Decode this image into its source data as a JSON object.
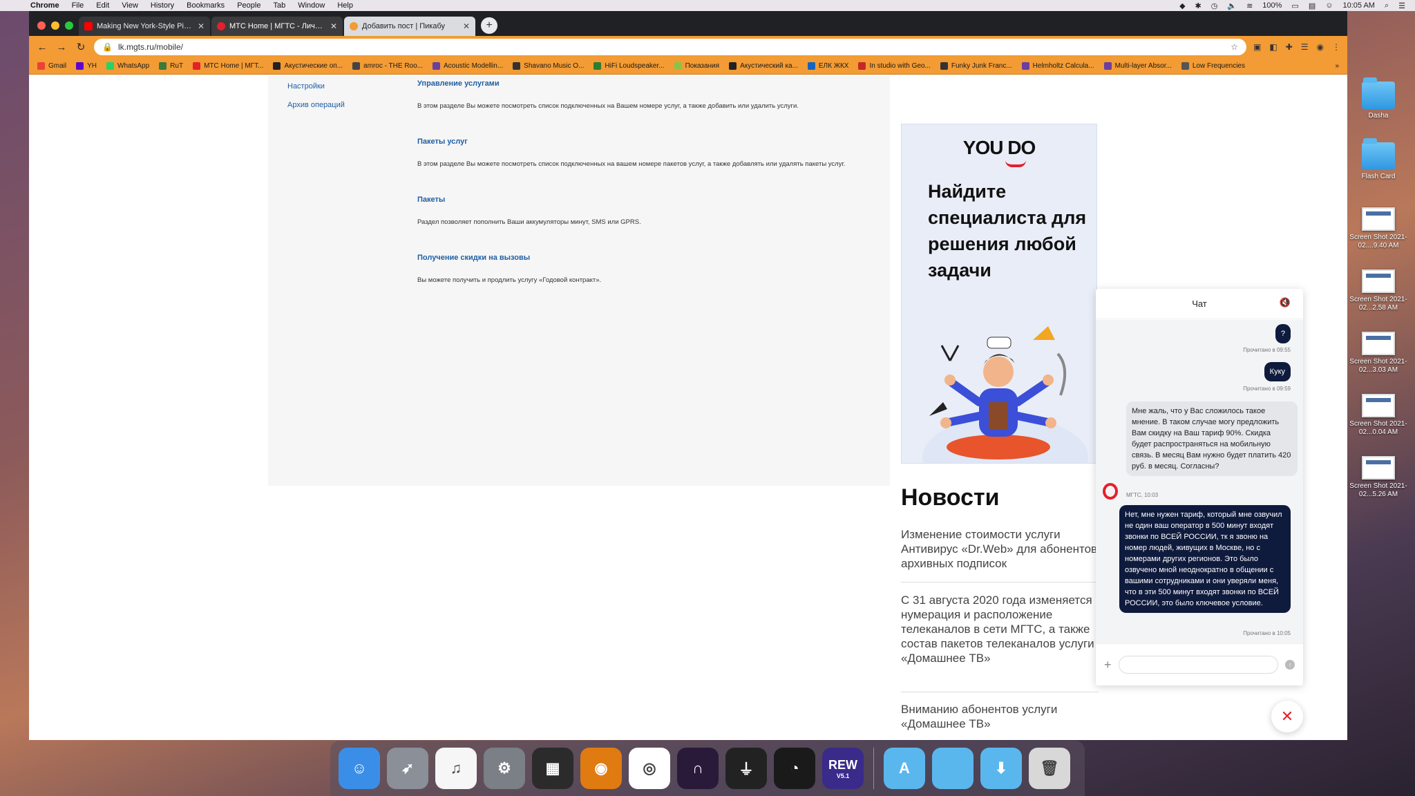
{
  "menubar": {
    "apple": "",
    "items": [
      "Chrome",
      "File",
      "Edit",
      "View",
      "History",
      "Bookmarks",
      "People",
      "Tab",
      "Window",
      "Help"
    ],
    "battery": "100%",
    "time": "10:05 AM"
  },
  "tabs": [
    {
      "title": "Making New York-Style Pizza a",
      "color": "#ff0000"
    },
    {
      "title": "МТС Home | МГТС - Личный ка",
      "color": "#e4202a"
    },
    {
      "title": "Добавить пост | Пикабу",
      "color": "#f39b34"
    }
  ],
  "address": {
    "url": "lk.mgts.ru/mobile/"
  },
  "bookmarks": [
    {
      "label": "Gmail",
      "color": "#ea4335"
    },
    {
      "label": "YH",
      "color": "#6001d2"
    },
    {
      "label": "WhatsApp",
      "color": "#25d366"
    },
    {
      "label": "RuT",
      "color": "#3a7a3a"
    },
    {
      "label": "МТС Home | МГТ...",
      "color": "#e4202a"
    },
    {
      "label": "Акустические оп...",
      "color": "#222222"
    },
    {
      "label": "amroc - THE Roo...",
      "color": "#444444"
    },
    {
      "label": "Acoustic Modellin...",
      "color": "#6b3fa0"
    },
    {
      "label": "Shavano Music O...",
      "color": "#333333"
    },
    {
      "label": "HiFi Loudspeaker...",
      "color": "#2e7d32"
    },
    {
      "label": "Показания",
      "color": "#8bc34a"
    },
    {
      "label": "Акустический ка...",
      "color": "#222222"
    },
    {
      "label": "ЕЛК ЖКХ",
      "color": "#1565c0"
    },
    {
      "label": "In studio with Geo...",
      "color": "#c62828"
    },
    {
      "label": "Funky Junk Franc...",
      "color": "#333333"
    },
    {
      "label": "Helmholtz Calcula...",
      "color": "#6b3fa0"
    },
    {
      "label": "Multi-layer Absor...",
      "color": "#6b3fa0"
    },
    {
      "label": "Low Frequencies",
      "color": "#555555"
    }
  ],
  "sidebar": {
    "items": [
      "Настройки",
      "Архив операций"
    ]
  },
  "services": [
    {
      "title": "Управление услугами",
      "desc": "В этом разделе Вы можете посмотреть список подключенных на Вашем номере услуг, а также добавить или удалить услуги."
    },
    {
      "title": "Пакеты услуг",
      "desc": "В этом разделе Вы можете посмотреть список подключенных на вашем номере пакетов услуг, а также добавлять или удалять пакеты услуг."
    },
    {
      "title": "Пакеты",
      "desc": "Раздел позволяет пополнить Ваши аккумуляторы минут, SMS или GPRS."
    },
    {
      "title": "Получение скидки на вызовы",
      "desc": "Вы можете получить и продлить услугу «Годовой контракт»."
    }
  ],
  "ad": {
    "logo": "YOU DO",
    "headline": "Найдите специалиста для решения любой задачи"
  },
  "news": {
    "title": "Новости",
    "items": [
      "Изменение стоимости услуги Антивирус «Dr.Web» для абонентов архивных подписок",
      "С 31 августа 2020 года изменяется нумерация и расположение телеканалов в сети МГТС, а также состав пакетов телеканалов услуги «Домашнее ТВ»",
      "Вниманию абонентов услуги «Домашнее ТВ»"
    ]
  },
  "chat": {
    "title": "Чат",
    "messages": [
      {
        "type": "out",
        "text": "?",
        "meta": "Прочитано в 09:55"
      },
      {
        "type": "out",
        "text": "Куку",
        "meta": "Прочитано в 09:59"
      },
      {
        "type": "in",
        "text": "Мне жаль, что у Вас сложилось такое мнение. В таком случае могу предложить Вам скидку на Ваш тариф 90%. Скидка будет распространяться на мобильную связь. В месяц Вам нужно будет платить 420 руб. в месяц. Согласны?",
        "meta": "МГТС, 10:03"
      },
      {
        "type": "out",
        "text": "Нет, мне нужен тариф, который мне озвучил не один ваш оператор в 500 минут входят звонки по ВСЕЙ РОССИИ, тк я звоню на номер людей, живущих в Москве, но с номерами других регионов. Это было озвучено мной неоднократно в общении с вашими сотрудниками и они уверяли меня, что в эти 500 минут входят звонки по ВСЕЙ РОССИИ, это было ключевое условие.",
        "meta": "Прочитано в 10:05"
      }
    ],
    "input_value": ""
  },
  "desktop": {
    "items": [
      {
        "label": "Dasha",
        "kind": "folder"
      },
      {
        "label": "Flash Card",
        "kind": "folder"
      },
      {
        "label": "Screen Shot 2021-02....9.40 AM",
        "kind": "shot"
      },
      {
        "label": "Screen Shot 2021-02...2.58 AM",
        "kind": "shot"
      },
      {
        "label": "Screen Shot 2021-02...3.03 AM",
        "kind": "shot"
      },
      {
        "label": "Screen Shot 2021-02...0.04 AM",
        "kind": "shot"
      },
      {
        "label": "Screen Shot 2021-02...5.26 AM",
        "kind": "shot"
      }
    ]
  },
  "dock": {
    "apps": [
      {
        "name": "finder-icon",
        "color": "#3b8ee8",
        "glyph": "☺"
      },
      {
        "name": "launchpad-icon",
        "color": "#8a8f98",
        "glyph": "➶"
      },
      {
        "name": "music-icon",
        "color": "#f6f6f6",
        "glyph": "♫"
      },
      {
        "name": "system-preferences-icon",
        "color": "#7b7f86",
        "glyph": "⚙"
      },
      {
        "name": "screenshot-app-icon",
        "color": "#2b2b2b",
        "glyph": "▦"
      },
      {
        "name": "speaker-app-icon",
        "color": "#e07b12",
        "glyph": "◉"
      },
      {
        "name": "chrome-icon",
        "color": "#ffffff",
        "glyph": "◎"
      },
      {
        "name": "pro-tools-icon",
        "color": "#2a1a3a",
        "glyph": "∩"
      },
      {
        "name": "uad-console-icon",
        "color": "#222222",
        "glyph": "⏚"
      },
      {
        "name": "uad-meter-icon",
        "color": "#1a1a1a",
        "glyph": "◔"
      },
      {
        "name": "rew-icon",
        "color": "#3a2a8a",
        "glyph": ""
      }
    ],
    "rew_label": "REW",
    "rew_version": "V5.1",
    "right_apps": [
      {
        "name": "applications-folder-icon",
        "color": "#5ab7ee",
        "glyph": "A"
      },
      {
        "name": "documents-folder-icon",
        "color": "#5ab7ee",
        "glyph": ""
      },
      {
        "name": "downloads-folder-icon",
        "color": "#5ab7ee",
        "glyph": "⬇"
      },
      {
        "name": "trash-icon",
        "color": "#d8d8d8",
        "glyph": "🗑"
      }
    ]
  }
}
